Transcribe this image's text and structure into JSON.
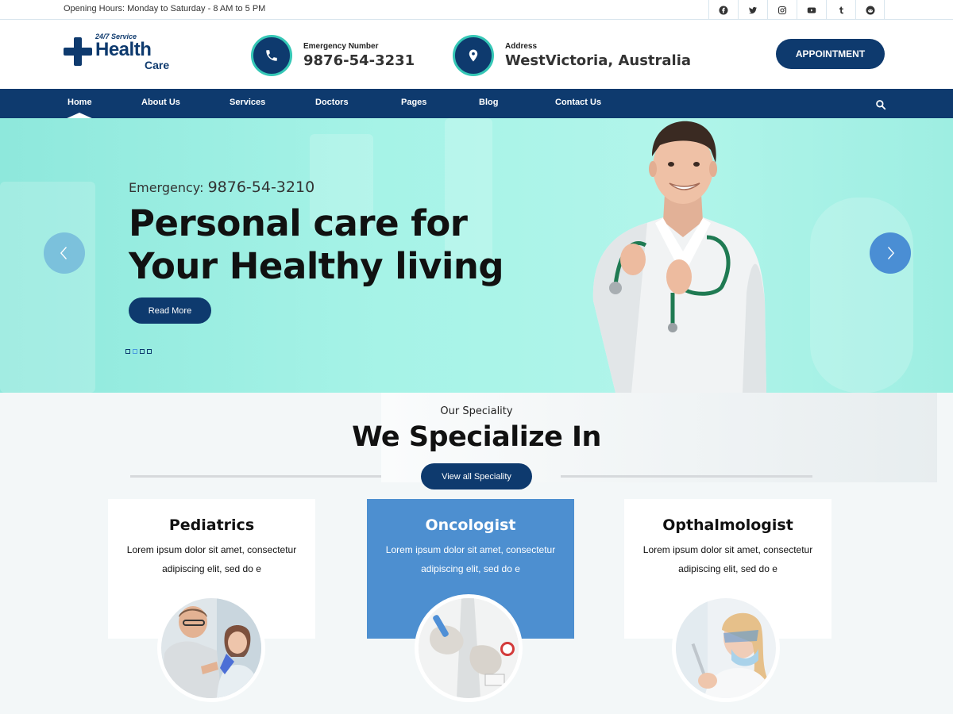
{
  "topbar": {
    "hours": "Opening Hours: Monday to Saturday - 8 AM to 5 PM",
    "social": [
      "facebook-icon",
      "twitter-icon",
      "instagram-icon",
      "youtube-icon",
      "tumblr-icon",
      "reddit-icon"
    ]
  },
  "header": {
    "logo": {
      "service": "24/7 Service",
      "health": "Health",
      "care": "Care"
    },
    "emergency": {
      "label": "Emergency Number",
      "value": "9876-54-3231",
      "icon": "phone-icon"
    },
    "address": {
      "label": "Address",
      "value": "WestVictoria, Australia",
      "icon": "map-pin-icon"
    },
    "appointment_label": "APPOINTMENT"
  },
  "nav": {
    "items": [
      "Home",
      "About Us",
      "Services",
      "Doctors",
      "Pages",
      "Blog",
      "Contact Us"
    ],
    "active": "Home",
    "search_icon": "search-icon"
  },
  "hero": {
    "emergency_prefix": "Emergency:",
    "emergency_number": "9876-54-3210",
    "heading_line1": "Personal care for",
    "heading_line2": "Your Healthy living",
    "button_label": "Read More",
    "slide_count": 4,
    "active_slide": 2
  },
  "speciality": {
    "subtitle": "Our Speciality",
    "title": "We Specialize In",
    "button_label": "View all Speciality",
    "cards": [
      {
        "title": "Pediatrics",
        "text": "Lorem ipsum dolor sit amet, consectetur adipiscing elit, sed do e",
        "highlighted": false
      },
      {
        "title": "Oncologist",
        "text": "Lorem ipsum dolor sit amet, consectetur adipiscing elit, sed do e",
        "highlighted": true
      },
      {
        "title": "Opthalmologist",
        "text": "Lorem ipsum dolor sit amet, consectetur adipiscing elit, sed do e",
        "highlighted": false
      }
    ]
  },
  "colors": {
    "primary": "#0e3a6e",
    "accent_teal": "#35c7b6",
    "hero_bg": "#9ff1e4",
    "highlight_card": "#4d8fd0"
  }
}
